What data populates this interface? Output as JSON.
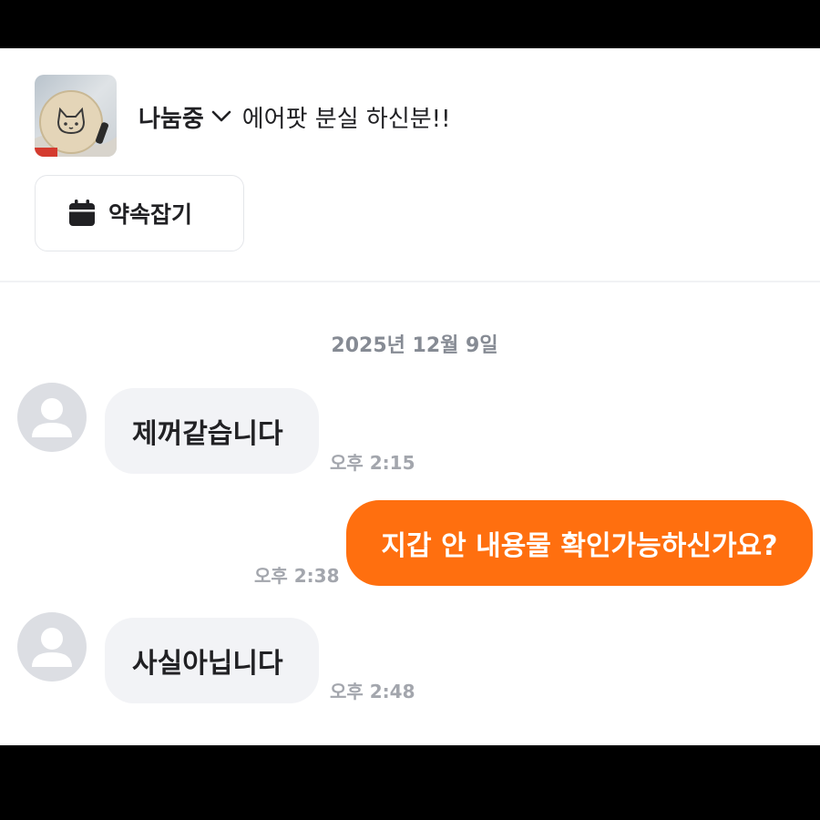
{
  "header": {
    "status": "나눔중",
    "title": "에어팟 분실 하신분!!",
    "appointment_button": "약속잡기"
  },
  "chat": {
    "date_separator": "2025년 12월 9일",
    "messages": [
      {
        "direction": "incoming",
        "text": "제꺼같습니다",
        "time": "오후 2:15"
      },
      {
        "direction": "outgoing",
        "text": "지갑 안 내용물 확인가능하신가요?",
        "time": "오후 2:38"
      },
      {
        "direction": "incoming",
        "text": "사실아닙니다",
        "time": "오후 2:48"
      }
    ]
  },
  "colors": {
    "accent": "#ff6f0f",
    "incoming_bubble": "#f2f3f6",
    "timestamp": "#a3a6ad",
    "date_separator": "#868b94"
  },
  "icons": {
    "calendar": "calendar-icon",
    "chevron": "chevron-down-icon",
    "avatar": "default-profile-icon"
  }
}
